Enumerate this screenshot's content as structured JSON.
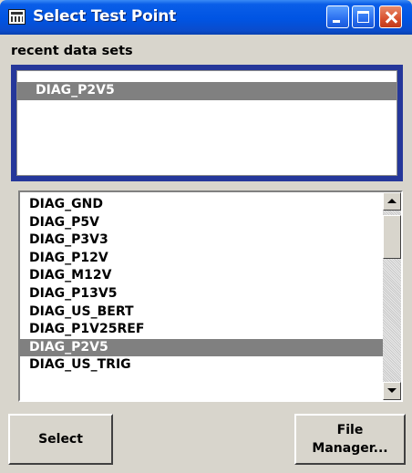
{
  "window": {
    "title": "Select Test Point",
    "icon": "keyboard-icon"
  },
  "recent": {
    "header": "recent data sets",
    "items": [
      "DIAG_P2V5"
    ],
    "selected_index": 0
  },
  "test_points": {
    "items": [
      "DIAG_GND",
      "DIAG_P5V",
      "DIAG_P3V3",
      "DIAG_P12V",
      "DIAG_M12V",
      "DIAG_P13V5",
      "DIAG_US_BERT",
      "DIAG_P1V25REF",
      "DIAG_P2V5",
      "DIAG_US_TRIG"
    ],
    "selected_index": 8
  },
  "buttons": {
    "select_label": "Select",
    "file_manager_line1": "File",
    "file_manager_line2": "Manager..."
  },
  "colors": {
    "titlebar": "#0054e3",
    "recent_frame": "#25379a",
    "selection": "#808080",
    "close_button": "#d8502e"
  }
}
